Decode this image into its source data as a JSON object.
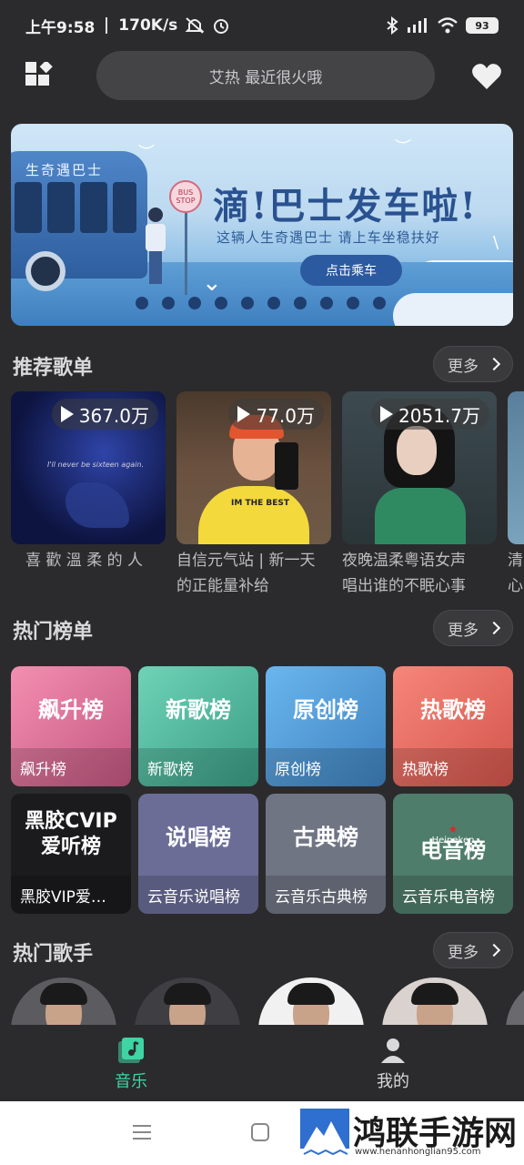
{
  "status_bar": {
    "time": "上午9:58",
    "speed": "170K/s",
    "battery": "93"
  },
  "header": {
    "search_placeholder": "艾热 最近很火哦"
  },
  "banner": {
    "bus_sign": "生奇遇巴士",
    "stop_sign": "BUS STOP",
    "title": "滴!巴士发车啦!",
    "subtitle": "这辆人生奇遇巴士   请上车坐稳扶好",
    "cta": "点击乘车",
    "dot_count": 10
  },
  "playlists_section": {
    "title": "推荐歌单",
    "more": "更多",
    "items": [
      {
        "count": "367.0万",
        "name_line1": "喜 歡 溫 柔 的 人",
        "name_line2": "",
        "cover_text": "I'll never be sixteen again."
      },
      {
        "count": "77.0万",
        "name_line1": "自信元气站 | 新一天",
        "name_line2": "的正能量补给",
        "cover_text": "IM THE BEST"
      },
      {
        "count": "2051.7万",
        "name_line1": "夜晚温柔粤语女声",
        "name_line2": "唱出谁的不眠心事",
        "cover_text": ""
      },
      {
        "count": "",
        "name_line1": "清",
        "name_line2": "心",
        "cover_text": ""
      }
    ]
  },
  "charts_section": {
    "title": "热门榜单",
    "more": "更多",
    "items": [
      {
        "big": "飙升榜",
        "label": "飙升榜"
      },
      {
        "big": "新歌榜",
        "label": "新歌榜"
      },
      {
        "big": "原创榜",
        "label": "原创榜"
      },
      {
        "big": "热歌榜",
        "label": "热歌榜"
      },
      {
        "big_line1": "黑胶CVIP",
        "big_line2": "爱听榜",
        "label": "黑胶VIP爱…"
      },
      {
        "big": "说唱榜",
        "label": "云音乐说唱榜"
      },
      {
        "big": "古典榜",
        "label": "云音乐古典榜"
      },
      {
        "big": "电音榜",
        "label": "云音乐电音榜",
        "brand": "Heineken"
      }
    ]
  },
  "singers_section": {
    "title": "热门歌手",
    "more": "更多"
  },
  "bottom_nav": {
    "music": "音乐",
    "me": "我的"
  },
  "watermark": {
    "text": "鸿联手游网",
    "url": "www.henanhonglian95.com"
  }
}
